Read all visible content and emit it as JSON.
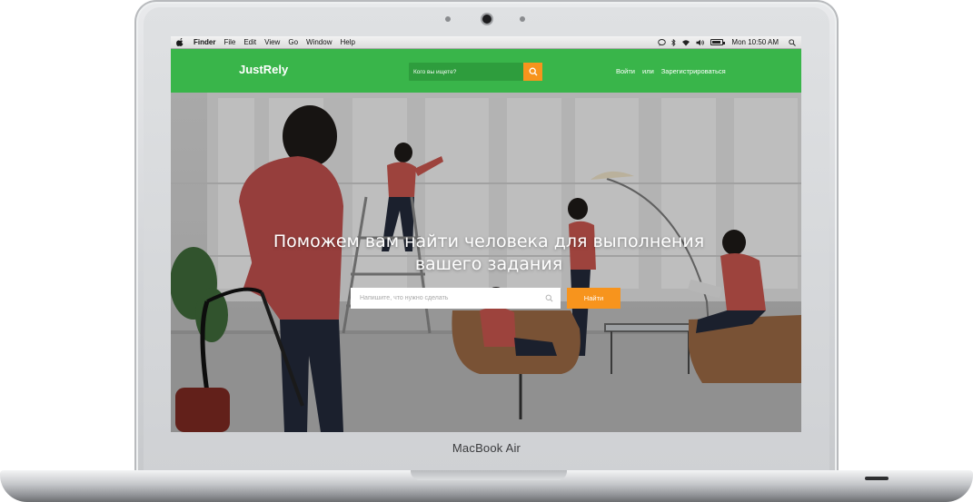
{
  "device": {
    "model_label": "MacBook Air"
  },
  "menubar": {
    "app_name": "Finder",
    "menus": [
      "File",
      "Edit",
      "View",
      "Go",
      "Window",
      "Help"
    ],
    "clock": "Mon 10:50 AM",
    "status_icons": [
      "message-icon",
      "bluetooth-icon",
      "wifi-icon",
      "volume-icon",
      "battery-icon",
      "spotlight-icon"
    ]
  },
  "header": {
    "logo": "JustRely",
    "search_placeholder": "Кого вы ищете?",
    "links": {
      "login": "Войти",
      "separator": "или",
      "register": "Зарегистрироваться"
    }
  },
  "hero": {
    "title_line1": "Поможем вам найти человека для выполнения",
    "title_line2": "вашего задания",
    "search_placeholder": "Напишите, что нужно сделать",
    "submit_label": "Найти"
  },
  "colors": {
    "header_green": "#39b54a",
    "accent_orange": "#f7941d"
  }
}
